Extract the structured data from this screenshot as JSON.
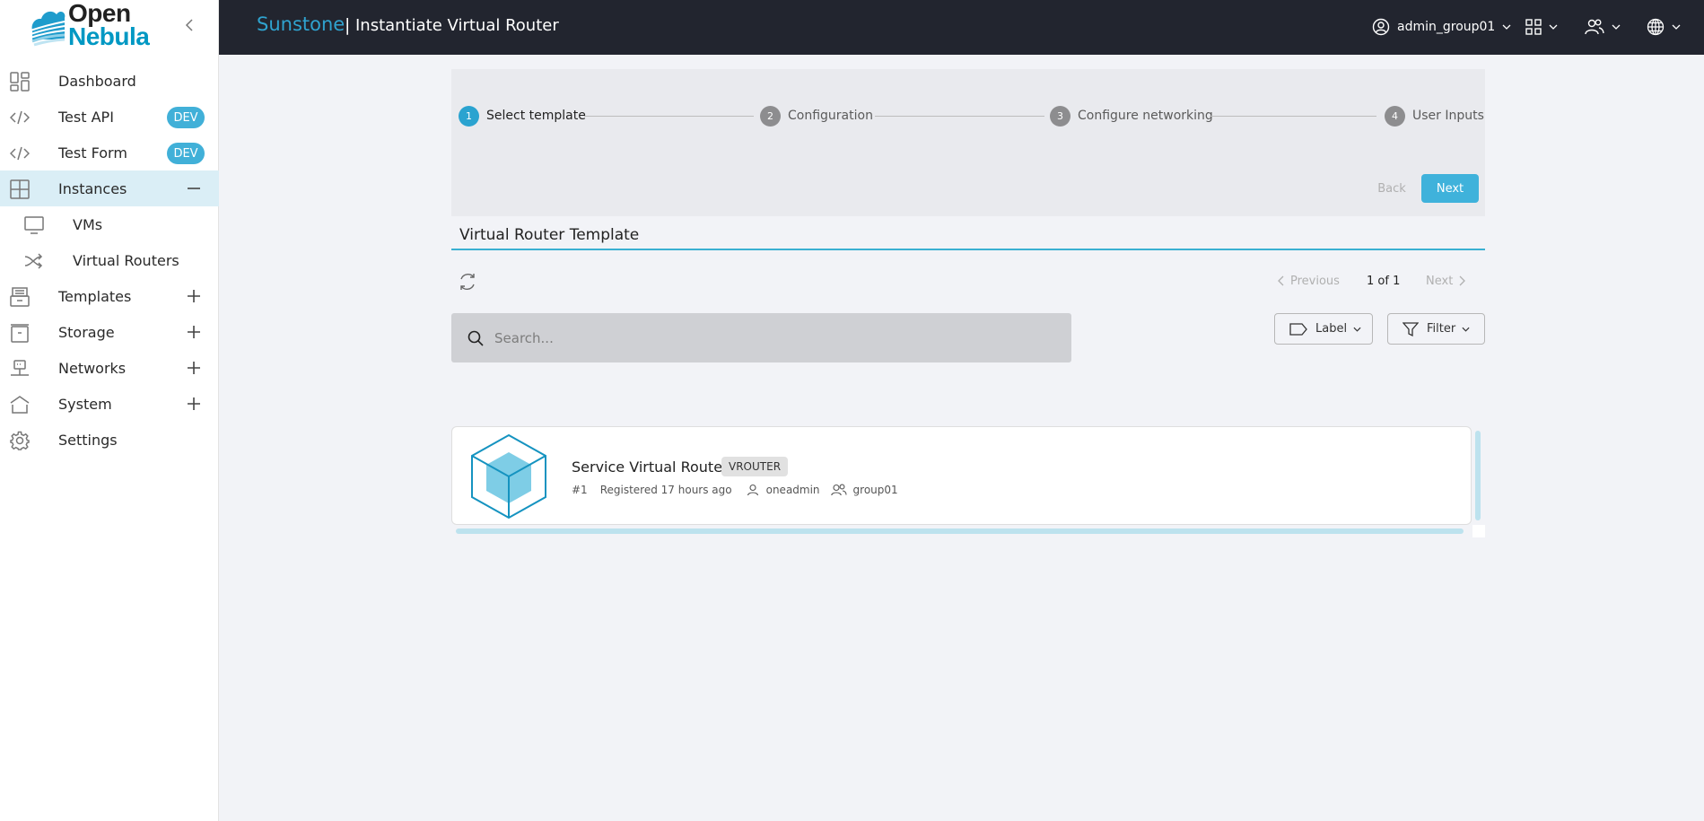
{
  "app": {
    "logo": {
      "line1": "Open",
      "line2": "Nebula"
    },
    "brand": "Sunstone",
    "separator": "|",
    "page_title": "Instantiate Virtual Router"
  },
  "header": {
    "user": {
      "label": "admin_group01",
      "icon": "user-circle-icon"
    },
    "views_icon": "grid-icon",
    "groups_icon": "group-icon",
    "language_icon": "globe-icon"
  },
  "sidebar": {
    "items": [
      {
        "label": "Dashboard",
        "icon": "dashboard-icon"
      },
      {
        "label": "Test API",
        "icon": "code-icon",
        "badge": "DEV"
      },
      {
        "label": "Test Form",
        "icon": "code-icon",
        "badge": "DEV"
      },
      {
        "label": "Instances",
        "icon": "instances-icon",
        "expanded": true,
        "toggle": "minus"
      },
      {
        "label": "VMs",
        "icon": "monitor-icon",
        "sub": true
      },
      {
        "label": "Virtual Routers",
        "icon": "shuffle-icon",
        "sub": true
      },
      {
        "label": "Templates",
        "icon": "templates-icon",
        "toggle": "plus"
      },
      {
        "label": "Storage",
        "icon": "storage-icon",
        "toggle": "plus"
      },
      {
        "label": "Networks",
        "icon": "network-icon",
        "toggle": "plus"
      },
      {
        "label": "System",
        "icon": "home-icon",
        "toggle": "plus"
      },
      {
        "label": "Settings",
        "icon": "gear-icon"
      }
    ]
  },
  "stepper": {
    "steps": [
      {
        "num": "1",
        "label": "Select template",
        "active": true
      },
      {
        "num": "2",
        "label": "Configuration"
      },
      {
        "num": "3",
        "label": "Configure networking"
      },
      {
        "num": "4",
        "label": "User Inputs"
      }
    ],
    "back_label": "Back",
    "next_label": "Next"
  },
  "section": {
    "title": "Virtual Router Template"
  },
  "toolbar": {
    "pager": {
      "prev": "Previous",
      "count": "1 of 1",
      "next": "Next"
    },
    "search_placeholder": "Search...",
    "label_button": "Label",
    "filter_button": "Filter"
  },
  "templates": [
    {
      "name": "Service Virtual Router",
      "tag": "VROUTER",
      "id": "#1",
      "registered": "Registered 17 hours ago",
      "owner": "oneadmin",
      "group": "group01"
    }
  ],
  "colors": {
    "accent": "#2aa3d0",
    "header_bg": "#22252f",
    "active_nav_bg": "#daeef6",
    "badge": "#41b0d8",
    "next_button": "#3fb2db"
  }
}
